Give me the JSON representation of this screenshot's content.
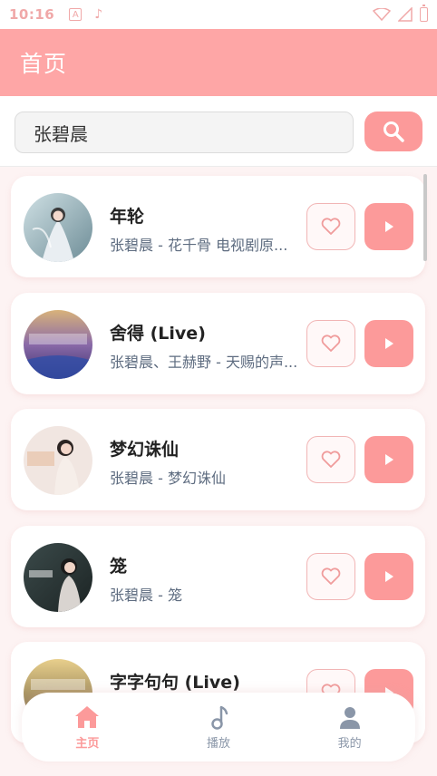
{
  "status_bar": {
    "time": "10:16",
    "indicator_letter": "A",
    "indicator_note": "♪"
  },
  "app_bar": {
    "title": "首页"
  },
  "search": {
    "value": "张碧晨",
    "button_icon": "search-icon"
  },
  "songs": [
    {
      "title": "年轮",
      "artist": "张碧晨 - 花千骨 电视剧原...",
      "like_icon": "heart-icon",
      "play_icon": "play-icon"
    },
    {
      "title": "舍得 (Live)",
      "artist": "张碧晨、王赫野 - 天赐的声...",
      "like_icon": "heart-icon",
      "play_icon": "play-icon"
    },
    {
      "title": "梦幻诛仙",
      "artist": "张碧晨 - 梦幻诛仙",
      "like_icon": "heart-icon",
      "play_icon": "play-icon"
    },
    {
      "title": "笼",
      "artist": "张碧晨 - 笼",
      "like_icon": "heart-icon",
      "play_icon": "play-icon"
    },
    {
      "title": "字字句句 (Live)",
      "artist": "",
      "like_icon": "heart-icon",
      "play_icon": "play-icon"
    }
  ],
  "bottom_nav": {
    "items": [
      {
        "label": "主页",
        "icon": "home-icon",
        "active": true
      },
      {
        "label": "播放",
        "icon": "music-note-icon",
        "active": false
      },
      {
        "label": "我的",
        "icon": "person-icon",
        "active": false
      }
    ]
  },
  "colors": {
    "accent": "#fc9a9a",
    "app_bar": "#fea6a6",
    "background": "#fdf3f3",
    "nav_inactive": "#8a96a8"
  }
}
